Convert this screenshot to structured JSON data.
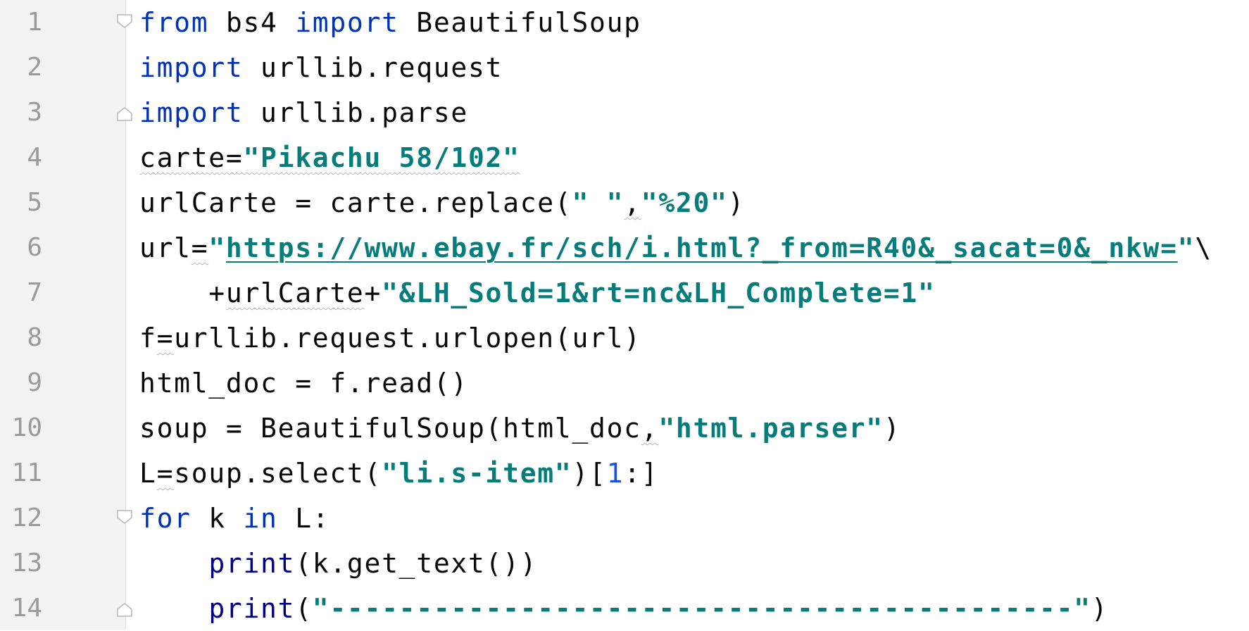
{
  "editor": {
    "language": "python",
    "colors": {
      "background": "#ffffff",
      "gutter": "#f2f2f2",
      "line_number": "#9a9a9a",
      "keyword": "#0033b3",
      "string": "#067d7b",
      "number": "#1750eb",
      "builtin": "#000080",
      "text": "#080808"
    },
    "lines": [
      {
        "number": "1",
        "fold": "open",
        "tokens": [
          {
            "t": "from",
            "c": "kw"
          },
          {
            "t": " bs4 "
          },
          {
            "t": "import",
            "c": "kw"
          },
          {
            "t": " BeautifulSoup"
          }
        ]
      },
      {
        "number": "2",
        "tokens": [
          {
            "t": "import",
            "c": "kw"
          },
          {
            "t": " urllib.request"
          }
        ]
      },
      {
        "number": "3",
        "fold": "close",
        "tokens": [
          {
            "t": "import",
            "c": "kw"
          },
          {
            "t": " urllib.parse"
          }
        ]
      },
      {
        "number": "4",
        "tokens": [
          {
            "t": "carte=",
            "c": "squig"
          },
          {
            "t": "\"Pikachu 58/102\"",
            "c": "str squig"
          }
        ]
      },
      {
        "number": "5",
        "tokens": [
          {
            "t": "urlCarte = carte.replace("
          },
          {
            "t": "\" \"",
            "c": "str"
          },
          {
            "t": ",",
            "c": "squig"
          },
          {
            "t": "\"%20\"",
            "c": "str"
          },
          {
            "t": ")"
          }
        ]
      },
      {
        "number": "6",
        "tokens": [
          {
            "t": "url"
          },
          {
            "t": "=",
            "c": "squig"
          },
          {
            "t": "\"",
            "c": "str"
          },
          {
            "t": "https://www.ebay.fr/sch/i.html?_from=R40&_sacat=0&_nkw=",
            "c": "str link"
          },
          {
            "t": "\"",
            "c": "str"
          },
          {
            "t": "\\"
          }
        ]
      },
      {
        "number": "7",
        "tokens": [
          {
            "t": "    +"
          },
          {
            "t": "urlCarte",
            "c": "squig"
          },
          {
            "t": "+"
          },
          {
            "t": "\"&LH_Sold=1&rt=nc&LH_Complete=1\"",
            "c": "str"
          }
        ]
      },
      {
        "number": "8",
        "tokens": [
          {
            "t": "f"
          },
          {
            "t": "=",
            "c": "squig"
          },
          {
            "t": "urllib.request.urlopen(url)"
          }
        ]
      },
      {
        "number": "9",
        "tokens": [
          {
            "t": "html_doc = f.read()"
          }
        ]
      },
      {
        "number": "10",
        "tokens": [
          {
            "t": "soup = BeautifulSoup(html_doc"
          },
          {
            "t": ",",
            "c": "squig"
          },
          {
            "t": "\"html.parser\"",
            "c": "str"
          },
          {
            "t": ")"
          }
        ]
      },
      {
        "number": "11",
        "tokens": [
          {
            "t": "L"
          },
          {
            "t": "=",
            "c": "squig"
          },
          {
            "t": "soup.select("
          },
          {
            "t": "\"li.s-item\"",
            "c": "str"
          },
          {
            "t": ")["
          },
          {
            "t": "1",
            "c": "num"
          },
          {
            "t": ":]"
          }
        ]
      },
      {
        "number": "12",
        "fold": "open",
        "tokens": [
          {
            "t": "for",
            "c": "kw"
          },
          {
            "t": " k "
          },
          {
            "t": "in",
            "c": "kw"
          },
          {
            "t": " L:"
          }
        ]
      },
      {
        "number": "13",
        "tokens": [
          {
            "t": "    "
          },
          {
            "t": "print",
            "c": "bi"
          },
          {
            "t": "(k.get_text())"
          }
        ]
      },
      {
        "number": "14",
        "fold": "close",
        "tokens": [
          {
            "t": "    "
          },
          {
            "t": "print",
            "c": "bi"
          },
          {
            "t": "("
          },
          {
            "t": "\"-------------------------------------------\"",
            "c": "str"
          },
          {
            "t": ")"
          }
        ]
      }
    ]
  }
}
